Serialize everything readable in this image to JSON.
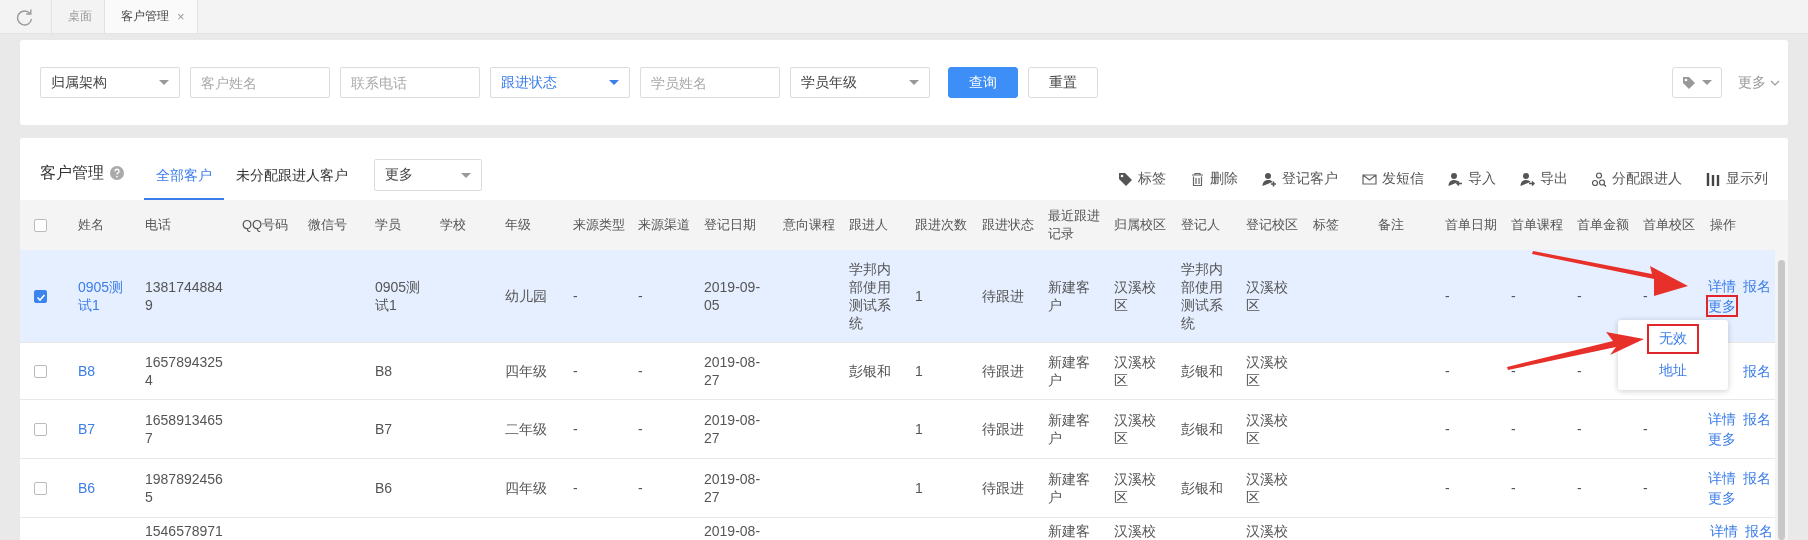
{
  "tabbar": {
    "tabs": [
      {
        "label": "桌面",
        "selected": false
      },
      {
        "label": "客户管理",
        "selected": true,
        "close": "×"
      }
    ]
  },
  "filters": {
    "fields": [
      {
        "kind": "select",
        "label": "归属架构",
        "active": false
      },
      {
        "kind": "input",
        "placeholder": "客户姓名"
      },
      {
        "kind": "input",
        "placeholder": "联系电话"
      },
      {
        "kind": "select",
        "label": "跟进状态",
        "active": true
      },
      {
        "kind": "input",
        "placeholder": "学员姓名"
      },
      {
        "kind": "select",
        "label": "学员年级",
        "active": false
      }
    ],
    "buttons": [
      {
        "label": "查询",
        "primary": true
      },
      {
        "label": "重置",
        "primary": false
      }
    ],
    "more": "更多"
  },
  "list": {
    "title": "客户管理",
    "views": [
      {
        "label": "全部客户",
        "selected": true
      },
      {
        "label": "未分配跟进人客户",
        "selected": false
      }
    ],
    "view_select": "更多",
    "actions": [
      {
        "kind": "tag",
        "label": "标签"
      },
      {
        "kind": "trash",
        "label": "删除"
      },
      {
        "kind": "user-add",
        "label": "登记客户"
      },
      {
        "kind": "mail",
        "label": "发短信"
      },
      {
        "kind": "user-in",
        "label": "导入"
      },
      {
        "kind": "user-out",
        "label": "导出"
      },
      {
        "kind": "assign",
        "label": "分配跟进人"
      },
      {
        "kind": "columns",
        "label": "显示列"
      }
    ],
    "select_all_checked": false,
    "columns": [
      "姓名",
      "电话",
      "QQ号码",
      "微信号",
      "学员",
      "学校",
      "年级",
      "来源类型",
      "来源渠道",
      "登记日期",
      "意向课程",
      "跟进人",
      "跟进次数",
      "跟进状态",
      "最近跟进记录",
      "归属校区",
      "登记人",
      "登记校区",
      "标签",
      "备注",
      "首单日期",
      "首单课程",
      "首单金额",
      "首单校区",
      "操作"
    ],
    "rows": [
      {
        "kind": "full",
        "selected": true,
        "name": "0905测试1",
        "phone": "13817448849",
        "student": "0905测试1",
        "grade": "幼儿园",
        "source_type": "-",
        "source_channel": "-",
        "reg_date": "2019-09-05",
        "follower": "学邦内部使用测试系统",
        "follow_count": "1",
        "follow_status": "待跟进",
        "recent_record": "新建客户",
        "campus": "汉溪校区",
        "registrar": "学邦内部使用测试系统",
        "reg_campus": "汉溪校区",
        "first_date": "-",
        "first_course": "-",
        "first_amount": "-",
        "first_campus": "-",
        "actions": [
          {
            "kind": "detail",
            "label": "详情"
          },
          {
            "kind": "enroll",
            "label": "报名"
          },
          {
            "kind": "more",
            "label": "更多",
            "outlined": true
          }
        ]
      },
      {
        "kind": "full",
        "selected": false,
        "name": "B8",
        "phone": "16578943254",
        "student": "B8",
        "grade": "四年级",
        "source_type": "-",
        "source_channel": "-",
        "reg_date": "2019-08-27",
        "follower": "彭银和",
        "follow_count": "1",
        "follow_status": "待跟进",
        "recent_record": "新建客户",
        "campus": "汉溪校区",
        "registrar": "彭银和",
        "reg_campus": "汉溪校区",
        "first_date": "-",
        "first_course": "-",
        "first_amount": "-",
        "actions": [
          {
            "kind": "enroll",
            "label": "报名"
          }
        ]
      },
      {
        "kind": "full",
        "selected": false,
        "name": "B7",
        "phone": "16589134657",
        "student": "B7",
        "grade": "二年级",
        "source_type": "-",
        "source_channel": "-",
        "reg_date": "2019-08-27",
        "follow_count": "1",
        "follow_status": "待跟进",
        "recent_record": "新建客户",
        "campus": "汉溪校区",
        "registrar": "彭银和",
        "reg_campus": "汉溪校区",
        "first_date": "-",
        "first_course": "-",
        "first_amount": "-",
        "first_campus": "-",
        "actions": [
          {
            "kind": "detail",
            "label": "详情"
          },
          {
            "kind": "enroll",
            "label": "报名"
          },
          {
            "kind": "more",
            "label": "更多",
            "outlined": false
          }
        ]
      },
      {
        "kind": "full",
        "selected": false,
        "name": "B6",
        "phone": "19878924565",
        "student": "B6",
        "grade": "四年级",
        "source_type": "-",
        "source_channel": "-",
        "reg_date": "2019-08-27",
        "follow_count": "1",
        "follow_status": "待跟进",
        "recent_record": "新建客户",
        "campus": "汉溪校区",
        "registrar": "彭银和",
        "reg_campus": "汉溪校区",
        "first_date": "-",
        "first_course": "-",
        "first_amount": "-",
        "first_campus": "-",
        "actions": [
          {
            "kind": "detail",
            "label": "详情"
          },
          {
            "kind": "enroll",
            "label": "报名"
          },
          {
            "kind": "more",
            "label": "更多",
            "outlined": false
          }
        ]
      },
      {
        "kind": "cut",
        "phone": "1546578971",
        "reg_date": "2019-08-",
        "recent_record": "新建客",
        "campus": "汉溪校",
        "reg_campus": "汉溪校",
        "actions": [
          {
            "kind": "detail",
            "label": "详情"
          },
          {
            "kind": "enroll",
            "label": "报名"
          }
        ]
      }
    ],
    "more_menu": {
      "items": [
        {
          "label": "无效",
          "outlined": true
        },
        {
          "label": "地址",
          "outlined": false
        }
      ]
    }
  }
}
